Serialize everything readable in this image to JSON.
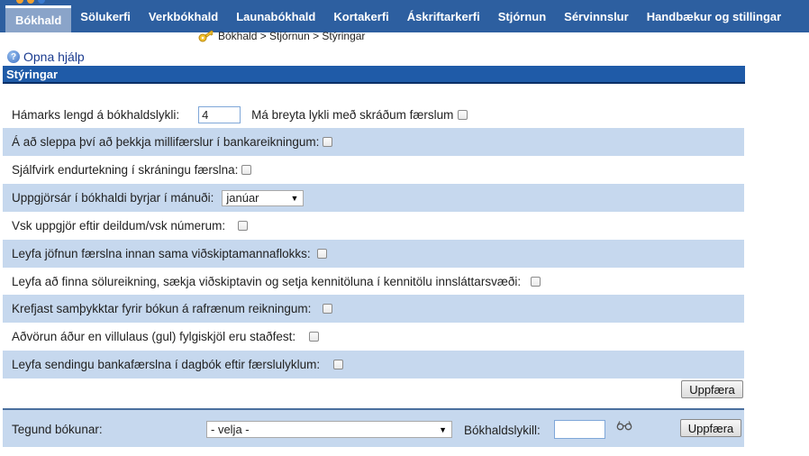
{
  "nav": {
    "items": [
      {
        "label": "Bókhald",
        "active": true
      },
      {
        "label": "Sölukerfi",
        "active": false
      },
      {
        "label": "Verkbókhald",
        "active": false
      },
      {
        "label": "Launabókhald",
        "active": false
      },
      {
        "label": "Kortakerfi",
        "active": false
      },
      {
        "label": "Áskriftarkerfi",
        "active": false
      },
      {
        "label": "Stjórnun",
        "active": false
      },
      {
        "label": "Sérvinnslur",
        "active": false
      },
      {
        "label": "Handbækur og stillingar",
        "active": false
      }
    ]
  },
  "breadcrumb": "Bókhald > Stjórnun > Stýringar",
  "help_link": "Opna hjálp",
  "section_title": "Stýringar",
  "settings": {
    "max_length_label": "Hámarks lengd á bókhaldslykli:",
    "max_length_value": "4",
    "change_key_label": "Má breyta lykli með skráðum færslum",
    "change_key_checked": false,
    "skip_transfer_label": "Á að sleppa því að þekkja millifærslur í bankareikningum:",
    "skip_transfer_checked": false,
    "auto_repeat_label": "Sjálfvirk endurtekning í skráningu færslna:",
    "auto_repeat_checked": false,
    "fiscal_year_label": "Uppgjörsár í bókhaldi byrjar í mánuði:",
    "fiscal_year_value": "janúar",
    "vat_label": "Vsk uppgjör eftir deildum/vsk númerum:",
    "vat_checked": false,
    "equalize_label": "Leyfa jöfnun færslna innan sama viðskiptamannaflokks:",
    "equalize_checked": false,
    "find_invoice_label": "Leyfa að finna sölureikning, sækja viðskiptavin og setja kennitöluna í kennitölu innsláttarsvæði:",
    "find_invoice_checked": false,
    "approval_label": "Krefjast samþykktar fyrir bókun á rafrænum reikningum:",
    "approval_checked": false,
    "warning_label": "Aðvörun áður en villulaus (gul) fylgiskjöl eru staðfest:",
    "warning_checked": false,
    "bank_send_label": "Leyfa sendingu bankafærslna í dagbók eftir færslulyklum:",
    "bank_send_checked": false
  },
  "update_button": "Uppfæra",
  "bottom": {
    "type_label": "Tegund bókunar:",
    "type_value": "- velja -",
    "key_label": "Bókhaldslykill:",
    "key_value": "",
    "update_button": "Uppfæra"
  }
}
